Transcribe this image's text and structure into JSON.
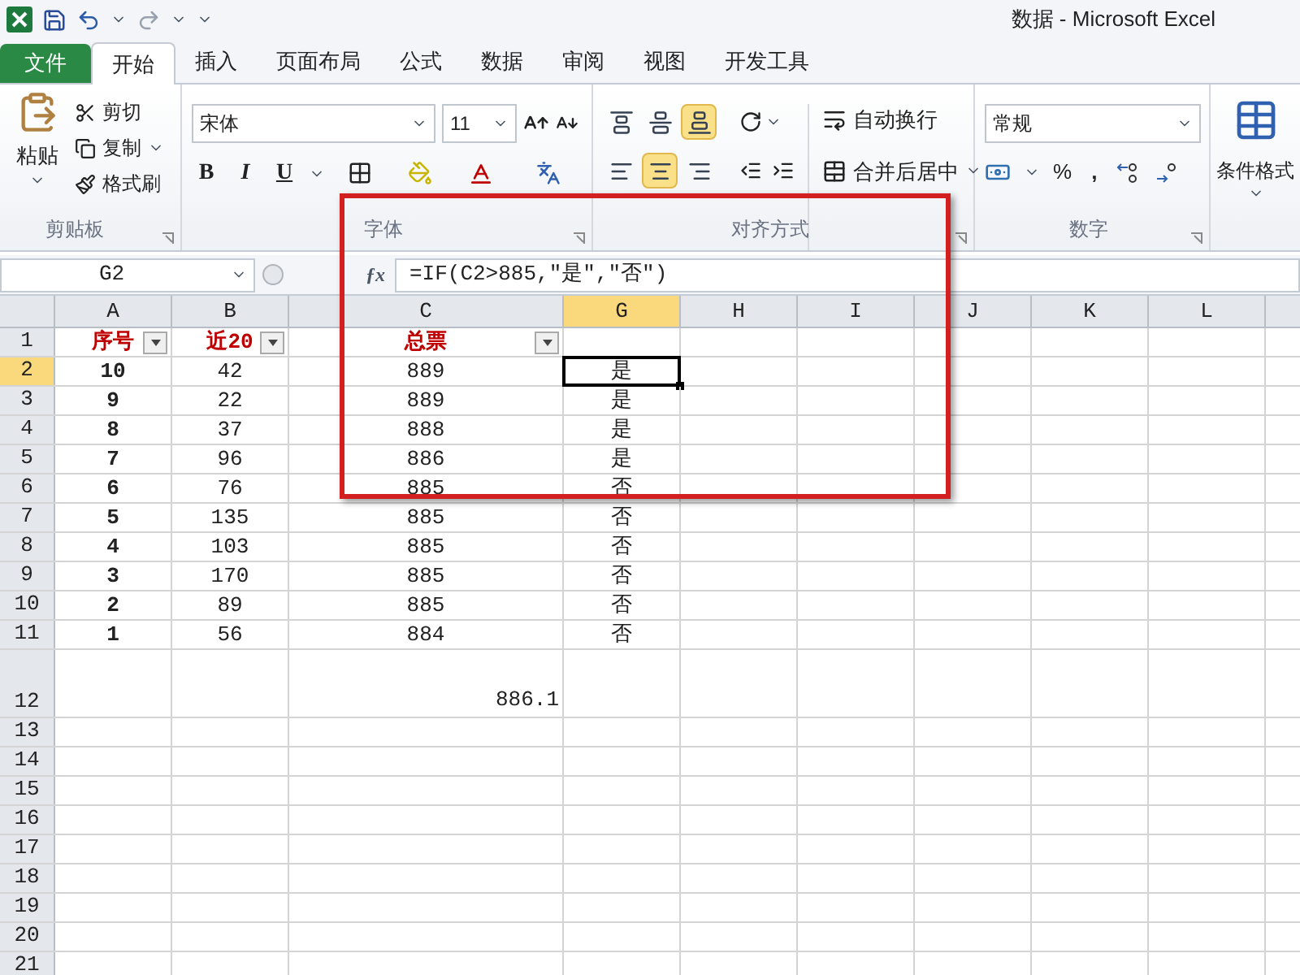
{
  "window": {
    "title": "数据  -  Microsoft Excel"
  },
  "tabs": [
    {
      "label": "文件",
      "kind": "file",
      "selected": false
    },
    {
      "label": "开始",
      "kind": "tab",
      "selected": true
    },
    {
      "label": "插入",
      "kind": "tab",
      "selected": false
    },
    {
      "label": "页面布局",
      "kind": "tab",
      "selected": false
    },
    {
      "label": "公式",
      "kind": "tab",
      "selected": false
    },
    {
      "label": "数据",
      "kind": "tab",
      "selected": false
    },
    {
      "label": "审阅",
      "kind": "tab",
      "selected": false
    },
    {
      "label": "视图",
      "kind": "tab",
      "selected": false
    },
    {
      "label": "开发工具",
      "kind": "tab",
      "selected": false
    }
  ],
  "clipboard": {
    "paste": "粘贴",
    "cut": "剪切",
    "copy": "复制",
    "format_painter": "格式刷",
    "label": "剪贴板"
  },
  "font": {
    "name": "宋体",
    "size": "11",
    "bold": "B",
    "italic": "I",
    "underline": "U",
    "label": "字体"
  },
  "alignment": {
    "vertical": [
      {
        "kind": "top",
        "selected": false
      },
      {
        "kind": "middle",
        "selected": false
      },
      {
        "kind": "bottom",
        "selected": true
      }
    ],
    "horizontal": [
      {
        "kind": "left",
        "selected": false
      },
      {
        "kind": "center",
        "selected": true
      },
      {
        "kind": "right",
        "selected": false
      }
    ],
    "wrap": "自动换行",
    "merge": "合并后居中",
    "label": "对齐方式"
  },
  "number": {
    "format": "常规",
    "percent": "%",
    "comma": ",",
    "label": "数字"
  },
  "styles": {
    "conditional": "条件格式"
  },
  "formula_bar": {
    "name_box": "G2",
    "function_button": "ƒx",
    "formula": "=IF(C2>885,\"是\",\"否\")"
  },
  "columns": [
    {
      "label": "A",
      "selected": false
    },
    {
      "label": "B",
      "selected": false
    },
    {
      "label": "C",
      "selected": false
    },
    {
      "label": "G",
      "selected": true
    },
    {
      "label": "H",
      "selected": false
    },
    {
      "label": "I",
      "selected": false
    },
    {
      "label": "J",
      "selected": false
    },
    {
      "label": "K",
      "selected": false
    },
    {
      "label": "L",
      "selected": false
    }
  ],
  "rows": [
    {
      "header": "1",
      "selected": false,
      "kind": "heading",
      "cells": [
        "序号",
        "近20",
        "总票"
      ]
    },
    {
      "header": "2",
      "selected": true,
      "cells": [
        "10",
        "42",
        "889",
        "是"
      ]
    },
    {
      "header": "3",
      "selected": false,
      "cells": [
        "9",
        "22",
        "889",
        "是"
      ]
    },
    {
      "header": "4",
      "selected": false,
      "cells": [
        "8",
        "37",
        "888",
        "是"
      ]
    },
    {
      "header": "5",
      "selected": false,
      "cells": [
        "7",
        "96",
        "886",
        "是"
      ]
    },
    {
      "header": "6",
      "selected": false,
      "cells": [
        "6",
        "76",
        "885",
        "否"
      ]
    },
    {
      "header": "7",
      "selected": false,
      "cells": [
        "5",
        "135",
        "885",
        "否"
      ]
    },
    {
      "header": "8",
      "selected": false,
      "cells": [
        "4",
        "103",
        "885",
        "否"
      ]
    },
    {
      "header": "9",
      "selected": false,
      "cells": [
        "3",
        "170",
        "885",
        "否"
      ]
    },
    {
      "header": "10",
      "selected": false,
      "cells": [
        "2",
        "89",
        "885",
        "否"
      ]
    },
    {
      "header": "11",
      "selected": false,
      "cells": [
        "1",
        "56",
        "884",
        "否"
      ]
    },
    {
      "header": "12",
      "selected": false,
      "kind": "summary",
      "cells": [
        null,
        null,
        "886.1"
      ]
    },
    {
      "header": "13",
      "selected": false
    },
    {
      "header": "14",
      "selected": false
    },
    {
      "header": "15",
      "selected": false
    },
    {
      "header": "16",
      "selected": false
    },
    {
      "header": "17",
      "selected": false
    },
    {
      "header": "18",
      "selected": false
    },
    {
      "header": "19",
      "selected": false
    },
    {
      "header": "20",
      "selected": false
    },
    {
      "header": "21",
      "selected": false
    }
  ]
}
